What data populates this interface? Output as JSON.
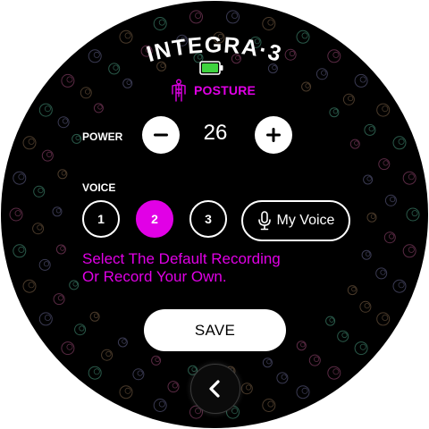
{
  "header": {
    "title": "INTEGRA·3",
    "battery_level": 1.0,
    "mode_label": "POSTURE"
  },
  "power": {
    "label": "POWER",
    "value": "26",
    "decrease_icon": "minus-icon",
    "increase_icon": "plus-icon"
  },
  "voice": {
    "label": "VOICE",
    "options": [
      "1",
      "2",
      "3"
    ],
    "selected": "2",
    "my_voice_label": "My Voice",
    "my_voice_icon": "microphone-icon"
  },
  "instruction": {
    "line1": "Select The Default Recording",
    "line2": "Or Record Your Own."
  },
  "save_label": "SAVE",
  "back_icon": "chevron-left-icon",
  "colors": {
    "background": "#000000",
    "accent": "#e100e6",
    "battery": "#3fd33f",
    "text": "#ffffff"
  }
}
